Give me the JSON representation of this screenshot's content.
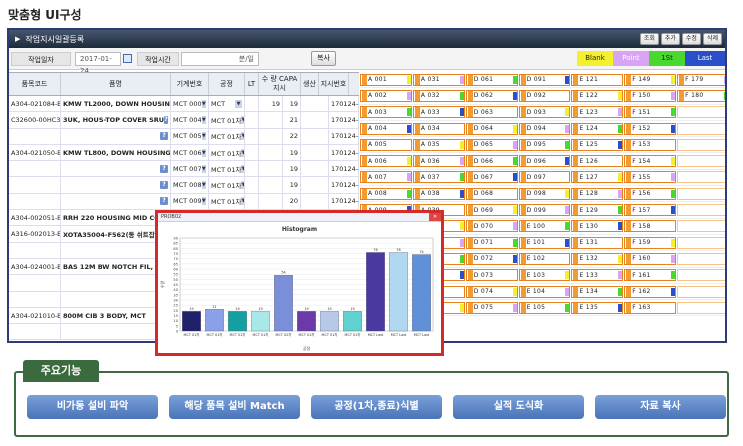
{
  "heading": "맞춤형 UI구성",
  "window": {
    "title": "작업지시일괄등록",
    "toolbar": [
      "조회",
      "추가",
      "수정",
      "삭제"
    ]
  },
  "filters": {
    "date_label": "작업일자",
    "date_value": "2017-01-24",
    "time_label": "작업시간",
    "time_value": "분/일",
    "copy_label": "복사"
  },
  "legend": [
    {
      "label": "Blank",
      "color": "#f5f02e"
    },
    {
      "label": "Point",
      "color": "#d8a4f3"
    },
    {
      "label": "1St",
      "color": "#49d830"
    },
    {
      "label": "Last",
      "color": "#2b4ec9"
    }
  ],
  "grid": {
    "headers": [
      "품목코드",
      "품명",
      "기계번호",
      "공정",
      "LT",
      "수 량 CAPA 지시",
      "생산",
      "지시번호"
    ],
    "rows": [
      {
        "code": "A304-021084-B",
        "name": "KMW TL2000, DOWN HOUSING",
        "machine": "MCT 000",
        "process": "MCT",
        "capa": "19",
        "qty": "19",
        "order": "170124-156"
      },
      {
        "code": "C32600-00HC3CM",
        "name": "3UK, HOUS-TOP COVER SRU",
        "machine": "MCT 004",
        "process": "MCT 01차",
        "capa": "",
        "qty": "21",
        "order": "170124-001"
      },
      {
        "code": "",
        "name": "",
        "machine": "MCT 005",
        "process": "MCT 01차",
        "capa": "",
        "qty": "22",
        "order": "170124-002"
      },
      {
        "code": "A304-021050-B",
        "name": "KMW TL800, DOWN HOUSING",
        "machine": "MCT 006",
        "process": "MCT 01차",
        "capa": "",
        "qty": "19",
        "order": "170124-003"
      },
      {
        "code": "",
        "name": "",
        "machine": "MCT 007",
        "process": "MCT 01차",
        "capa": "",
        "qty": "19",
        "order": "170124-004"
      },
      {
        "code": "",
        "name": "",
        "machine": "MCT 008",
        "process": "MCT 01차",
        "capa": "",
        "qty": "19",
        "order": "170124-005"
      },
      {
        "code": "",
        "name": "",
        "machine": "MCT 009",
        "process": "MCT 01차",
        "capa": "",
        "qty": "20",
        "order": "170124-006"
      },
      {
        "code": "A304-002051-B",
        "name": "RRH 220 HOUSING MID CO",
        "machine": "",
        "process": "",
        "capa": "",
        "qty": "",
        "order": ""
      },
      {
        "code": "A316-002013-B",
        "name": "XOTA35004-F562(동 쉬트잡",
        "machine": "",
        "process": "",
        "capa": "",
        "qty": "",
        "order": ""
      },
      {
        "code": "",
        "name": "",
        "machine": "",
        "process": "",
        "capa": "",
        "qty": "",
        "order": ""
      },
      {
        "code": "A304-024001-B",
        "name": "BAS 12M BW NOTCH FIL,",
        "machine": "",
        "process": "",
        "capa": "",
        "qty": "",
        "order": ""
      },
      {
        "code": "",
        "name": "",
        "machine": "",
        "process": "",
        "capa": "",
        "qty": "",
        "order": ""
      },
      {
        "code": "",
        "name": "",
        "machine": "",
        "process": "",
        "capa": "",
        "qty": "",
        "order": ""
      },
      {
        "code": "A304-021010-B",
        "name": "800M CIB 3 BODY, MCT",
        "machine": "",
        "process": "",
        "capa": "",
        "qty": "",
        "order": ""
      },
      {
        "code": "",
        "name": "",
        "machine": "",
        "process": "",
        "capa": "",
        "qty": "",
        "order": ""
      }
    ]
  },
  "slots": {
    "columns": [
      [
        "A 001",
        "A 002",
        "A 003",
        "A 004",
        "A 005",
        "A 006",
        "A 007",
        "A 008",
        "A 009",
        "A 010",
        "A 011",
        "A 012",
        "A 013",
        "A 014",
        "A 015"
      ],
      [
        "A 031",
        "A 032",
        "A 033",
        "A 034",
        "A 035",
        "A 036",
        "A 037",
        "A 038",
        "A 039",
        "A 040",
        "A 041",
        "A 042",
        "A 043",
        "A 044",
        "A 045"
      ],
      [
        "D 061",
        "D 062",
        "D 063",
        "D 064",
        "D 065",
        "D 066",
        "D 067",
        "D 068",
        "D 069",
        "D 070",
        "D 071",
        "D 072",
        "D 073",
        "D 074",
        "D 075"
      ],
      [
        "D 091",
        "D 092",
        "D 093",
        "D 094",
        "D 095",
        "D 096",
        "D 097",
        "D 098",
        "D 099",
        "E 100",
        "E 101",
        "E 102",
        "E 103",
        "E 104",
        "E 105"
      ],
      [
        "E 121",
        "E 122",
        "E 123",
        "E 124",
        "E 125",
        "E 126",
        "E 127",
        "E 128",
        "E 129",
        "E 130",
        "E 131",
        "E 132",
        "E 133",
        "E 134",
        "E 135"
      ],
      [
        "F 149",
        "F 150",
        "F 151",
        "F 152",
        "F 153",
        "F 154",
        "F 155",
        "F 156",
        "F 157",
        "F 158",
        "F 159",
        "F 160",
        "F 161",
        "F 162",
        "F 163"
      ],
      [
        "F 179",
        "F 180",
        "",
        "",
        "",
        "",
        "",
        "",
        "",
        "",
        "",
        "",
        "",
        "",
        ""
      ]
    ]
  },
  "popup": {
    "window_title": "PROB02",
    "title": "Histogram",
    "ylabel": "수량",
    "xlabel": "공정"
  },
  "chart_data": {
    "type": "bar",
    "title": "Histogram",
    "ylabel": "수량",
    "xlabel": "공정",
    "ylim": [
      0,
      90
    ],
    "yticks": [
      0,
      5,
      10,
      15,
      20,
      25,
      30,
      35,
      40,
      45,
      50,
      55,
      60,
      65,
      70,
      75,
      80,
      85,
      90
    ],
    "categories": [
      "MCT 01차",
      "MCT 01차",
      "MCT 01차",
      "MCT 01차",
      "MCT 02차",
      "MCT 01차",
      "MCT 01차",
      "MCT 01차",
      "MCT Last",
      "MCT Last",
      "MCT Last"
    ],
    "values": [
      19,
      21,
      19,
      19,
      54,
      19,
      19,
      19,
      76,
      76,
      74
    ],
    "colors": [
      "#20206a",
      "#8aa0e8",
      "#14a0a0",
      "#a8e8e8",
      "#7a8fd8",
      "#6a3aa8",
      "#b8c8e8",
      "#60d0d0",
      "#4a3aa0",
      "#b0d8f0",
      "#6090d8"
    ]
  },
  "features": {
    "title": "주요기능",
    "buttons": [
      "비가동 설비 파악",
      "해당 품목 설비 Match",
      "공정(1차,종료)식별",
      "실적 도식화",
      "자료 복사"
    ]
  }
}
